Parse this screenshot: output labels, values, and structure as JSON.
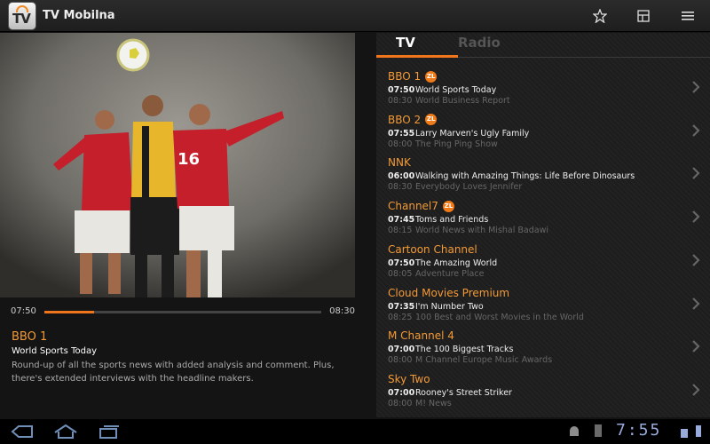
{
  "app": {
    "title": "TV Mobilna",
    "icon": "tv-app-logo",
    "icon_text": "TV"
  },
  "actions": [
    {
      "name": "favorite-star-icon"
    },
    {
      "name": "guide-layout-icon"
    },
    {
      "name": "menu-icon"
    }
  ],
  "player": {
    "start_time": "07:50",
    "end_time": "08:30",
    "progress_percent": 18,
    "channel": "BBO 1",
    "program": "World Sports Today",
    "description": "Round-up of all the sports news with added analysis and comment. Plus, there's extended interviews with the headline makers."
  },
  "tabs": [
    {
      "label": "TV",
      "active": true
    },
    {
      "label": "Radio",
      "active": false
    }
  ],
  "channels": [
    {
      "name": "BBO 1",
      "badge": "ZL",
      "now_time": "07:50",
      "now": "World Sports Today",
      "next_time": "08:30",
      "next": "World Business Report"
    },
    {
      "name": "BBO 2",
      "badge": "ZL",
      "now_time": "07:55",
      "now": "Larry Marven's Ugly Family",
      "next_time": "08:00",
      "next": "The Ping Ping Show"
    },
    {
      "name": "NNK",
      "badge": "",
      "now_time": "06:00",
      "now": "Walking with Amazing Things: Life Before Dinosaurs",
      "next_time": "08:30",
      "next": "Everybody Loves Jennifer"
    },
    {
      "name": "Channel7",
      "badge": "ZL",
      "now_time": "07:45",
      "now": "Toms and Friends",
      "next_time": "08:15",
      "next": "World News with Mishal Badawi"
    },
    {
      "name": "Cartoon Channel",
      "badge": "",
      "now_time": "07:50",
      "now": "The Amazing World",
      "next_time": "08:05",
      "next": "Adventure Place"
    },
    {
      "name": "Cloud Movies Premium",
      "badge": "",
      "now_time": "07:35",
      "now": "I'm Number Two",
      "next_time": "08:25",
      "next": "100 Best and Worst Movies in the World"
    },
    {
      "name": "M Channel 4",
      "badge": "",
      "now_time": "07:00",
      "now": "The 100 Biggest Tracks",
      "next_time": "08:00",
      "next": "M Channel Europe Music Awards"
    },
    {
      "name": "Sky Two",
      "badge": "",
      "now_time": "07:00",
      "now": "Rooney's Street Striker",
      "next_time": "08:00",
      "next": "M! News"
    }
  ],
  "system": {
    "clock": "7:55"
  },
  "colors": {
    "accent": "#f0761d",
    "channel": "#f39a36"
  }
}
